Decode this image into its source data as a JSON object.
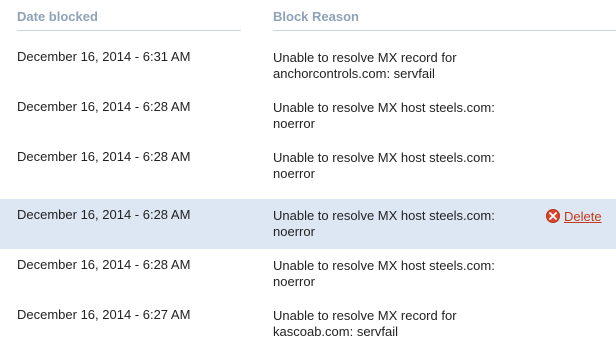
{
  "columns": {
    "date": "Date blocked",
    "reason": "Block Reason"
  },
  "rows": [
    {
      "date": "December 16, 2014 - 6:31 AM",
      "reason": "Unable to resolve MX record for anchorcontrols.com: servfail",
      "selected": false
    },
    {
      "date": "December 16, 2014 - 6:28 AM",
      "reason": "Unable to resolve MX host steels.com: noerror",
      "selected": false
    },
    {
      "date": "December 16, 2014 - 6:28 AM",
      "reason": "Unable to resolve MX host steels.com: noerror",
      "selected": false
    },
    {
      "date": "December 16, 2014 - 6:28 AM",
      "reason": "Unable to resolve MX host steels.com: noerror",
      "selected": true,
      "action": "Delete"
    },
    {
      "date": "December 16, 2014 - 6:28 AM",
      "reason": "Unable to resolve MX host steels.com: noerror",
      "selected": false
    },
    {
      "date": "December 16, 2014 - 6:27 AM",
      "reason": "Unable to resolve MX record for kascoab.com: servfail",
      "selected": false
    }
  ],
  "colors": {
    "header_text": "#8fa2b9",
    "selected_row": "#dce7f3",
    "delete_accent": "#c33a1c"
  },
  "icons": {
    "delete": "close-circle-icon"
  }
}
